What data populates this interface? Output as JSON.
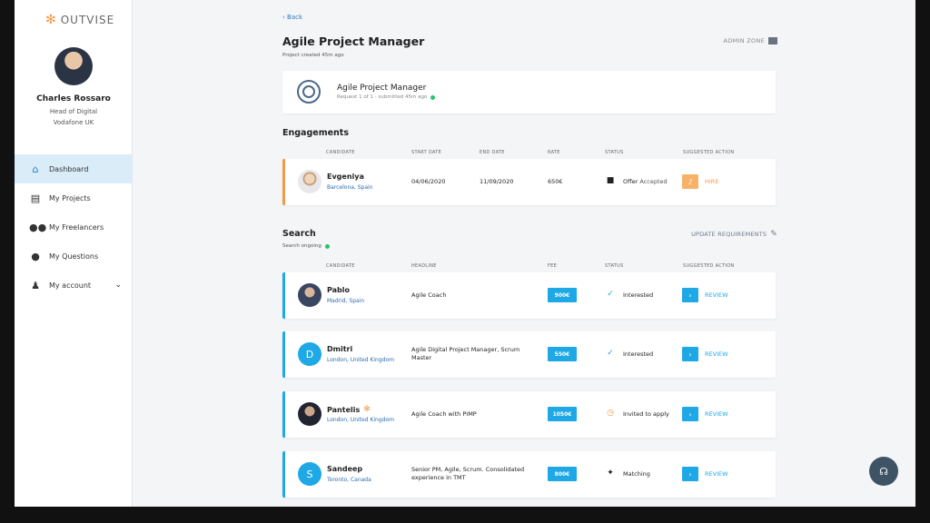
{
  "brand": {
    "name": "OUTVISE",
    "accent": "#f2994a",
    "primary": "#1fa8e6"
  },
  "user": {
    "name": "Charles Rossaro",
    "role": "Head of Digital",
    "company": "Vodafone UK"
  },
  "nav": {
    "items": [
      {
        "label": "Dashboard",
        "icon": "home-icon"
      },
      {
        "label": "My Projects",
        "icon": "documents-icon"
      },
      {
        "label": "My Freelancers",
        "icon": "users-icon"
      },
      {
        "label": "My Questions",
        "icon": "chat-icon"
      },
      {
        "label": "My account",
        "icon": "user-icon"
      }
    ]
  },
  "page": {
    "back_label": "Back",
    "title": "Agile Project Manager",
    "created": "Project created 45m ago",
    "admin_zone": "ADMIN ZONE"
  },
  "request": {
    "title": "Agile Project Manager",
    "subtitle": "Request 1 of 1 - submitted 45m ago"
  },
  "engagements": {
    "title": "Engagements",
    "headers": {
      "candidate": "CANDIDATE",
      "start": "START DATE",
      "end": "END DATE",
      "rate": "RATE",
      "status": "STATUS",
      "action": "SUGGESTED ACTION"
    },
    "rows": [
      {
        "name": "Evgeniya",
        "location": "Barcelona, Spain",
        "start": "04/06/2020",
        "end": "11/09/2020",
        "rate": "650€",
        "status_strong": "Offer",
        "status_rest": "Accepted",
        "action": "HIRE"
      }
    ]
  },
  "search": {
    "title": "Search",
    "status": "Search ongoing",
    "update_label": "UPDATE REQUIREMENTS",
    "headers": {
      "candidate": "CANDIDATE",
      "headline": "HEADLINE",
      "fee": "FEE",
      "status": "STATUS",
      "action": "SUGGESTED ACTION"
    },
    "rows": [
      {
        "name": "Pablo",
        "location": "Madrid, Spain",
        "headline": "Agile Coach",
        "fee": "900€",
        "status": "Interested",
        "action": "REVIEW"
      },
      {
        "name": "Dmitri",
        "initial": "D",
        "location": "London, United Kingdom",
        "headline": "Agile Digital Project Manager, Scrum Master",
        "fee": "550€",
        "status": "Interested",
        "action": "REVIEW"
      },
      {
        "name": "Pantelis",
        "location": "London, United Kingdom",
        "headline": "Agile Coach with PIMP",
        "fee": "1050€",
        "status": "Invited to apply",
        "action": "REVIEW"
      },
      {
        "name": "Sandeep",
        "initial": "S",
        "location": "Toronto, Canada",
        "headline": "Senior PM, Agile, Scrum. Consolidated experience in TMT",
        "fee": "800€",
        "status": "Matching",
        "action": "REVIEW"
      }
    ]
  }
}
